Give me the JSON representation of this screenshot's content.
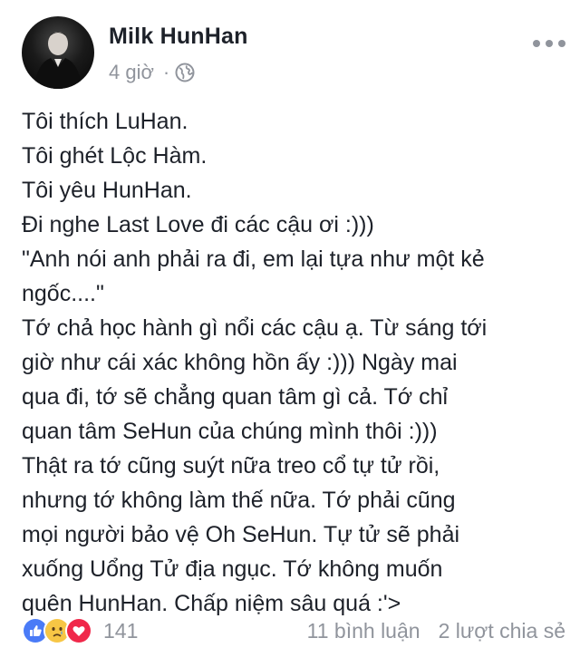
{
  "post": {
    "author": "Milk HunHan",
    "time": "4 giờ",
    "separator": "·",
    "privacy_icon": "globe-icon",
    "lines": [
      "Tôi thích LuHan.",
      "Tôi ghét Lộc Hàm.",
      "Tôi yêu HunHan.",
      "Đi nghe Last Love đi các cậu ơi :)))",
      "\"Anh nói anh phải ra đi, em lại tựa như một kẻ",
      "ngốc....\"",
      "Tớ chả học hành gì nổi các cậu ạ. Từ sáng tới",
      "giờ như cái xác không hồn ấy :))) Ngày mai",
      "qua đi, tớ sẽ chẳng quan tâm gì cả. Tớ chỉ",
      "quan tâm SeHun của chúng mình thôi :)))",
      "Thật ra tớ cũng suýt nữa treo cổ tự tử rồi,",
      "nhưng tớ không làm thế nữa. Tớ phải cũng",
      "mọi người bảo vệ Oh SeHun. Tự tử sẽ phải",
      "xuống Uổng Tử địa ngục. Tớ không muốn",
      "quên HunHan. Chấp niệm sâu quá :'>"
    ]
  },
  "footer": {
    "reaction_icons": [
      "like-icon",
      "sad-icon",
      "love-icon"
    ],
    "reaction_count": "141",
    "comments": "11 bình luận",
    "shares": "2 lượt chia sẻ"
  },
  "colors": {
    "text": "#1d2129",
    "secondary": "#90949c",
    "like": "#4a7bf7",
    "love": "#f0284a",
    "sad": "#f7c645"
  }
}
